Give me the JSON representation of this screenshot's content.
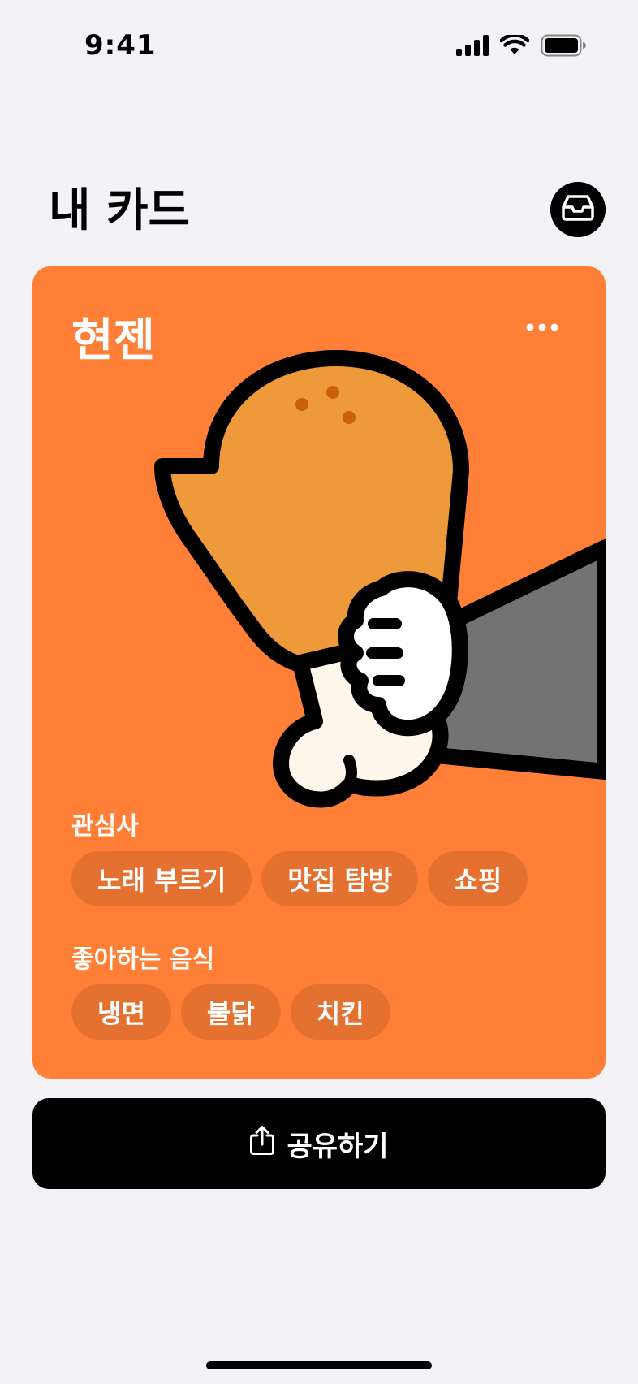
{
  "status_bar": {
    "time": "9:41",
    "icons": [
      "cellular-signal-icon",
      "wifi-icon",
      "battery-icon"
    ]
  },
  "header": {
    "title": "내 카드",
    "inbox_icon": "inbox-tray-icon"
  },
  "card": {
    "name": "현젠",
    "menu_icon": "more-horizontal-icon",
    "illustration": "chicken-drumstick-in-hand",
    "background_color": "#ff7f36",
    "interests": {
      "label": "관심사",
      "items": [
        "노래 부르기",
        "맛집 탐방",
        "쇼핑"
      ]
    },
    "favorite_foods": {
      "label": "좋아하는 음식",
      "items": [
        "냉면",
        "불닭",
        "치킨"
      ]
    }
  },
  "share_button": {
    "label": "공유하기",
    "icon": "share-icon"
  }
}
